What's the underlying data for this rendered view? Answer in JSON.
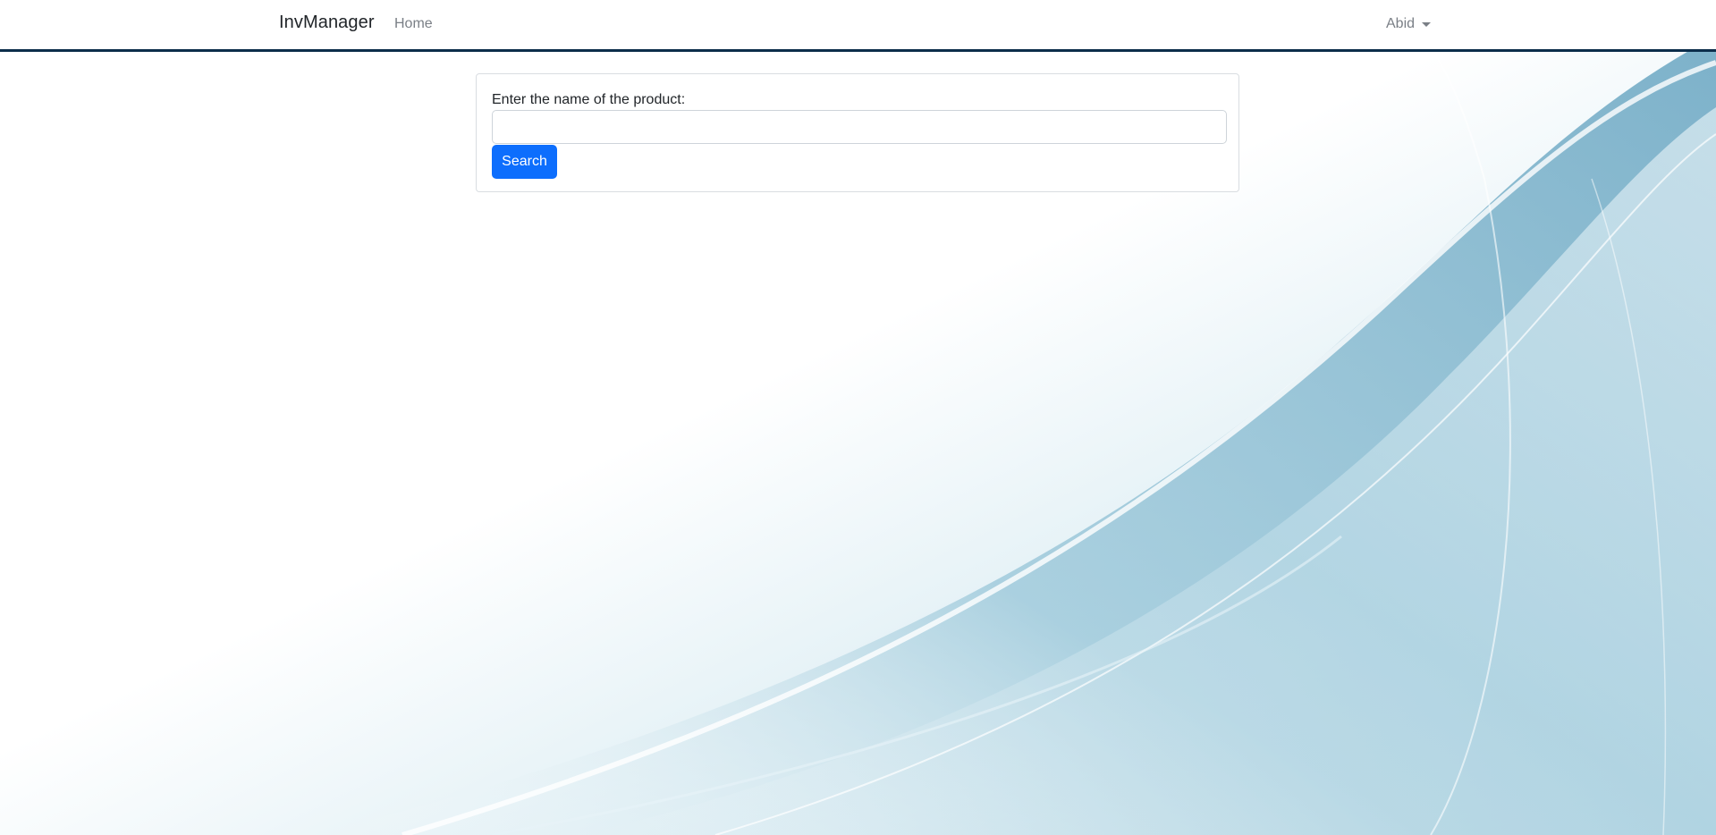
{
  "navbar": {
    "brand": "InvManager",
    "home_link": "Home",
    "user_name": "Abid",
    "border_color": "#0b2d4a"
  },
  "search_form": {
    "label": "Enter the name of the product:",
    "input_value": "",
    "input_placeholder": "",
    "button_label": "Search",
    "button_color": "#0d6efd"
  },
  "background": {
    "style": "abstract-light-blue-waves",
    "accent_color": "#7fb6cd"
  }
}
